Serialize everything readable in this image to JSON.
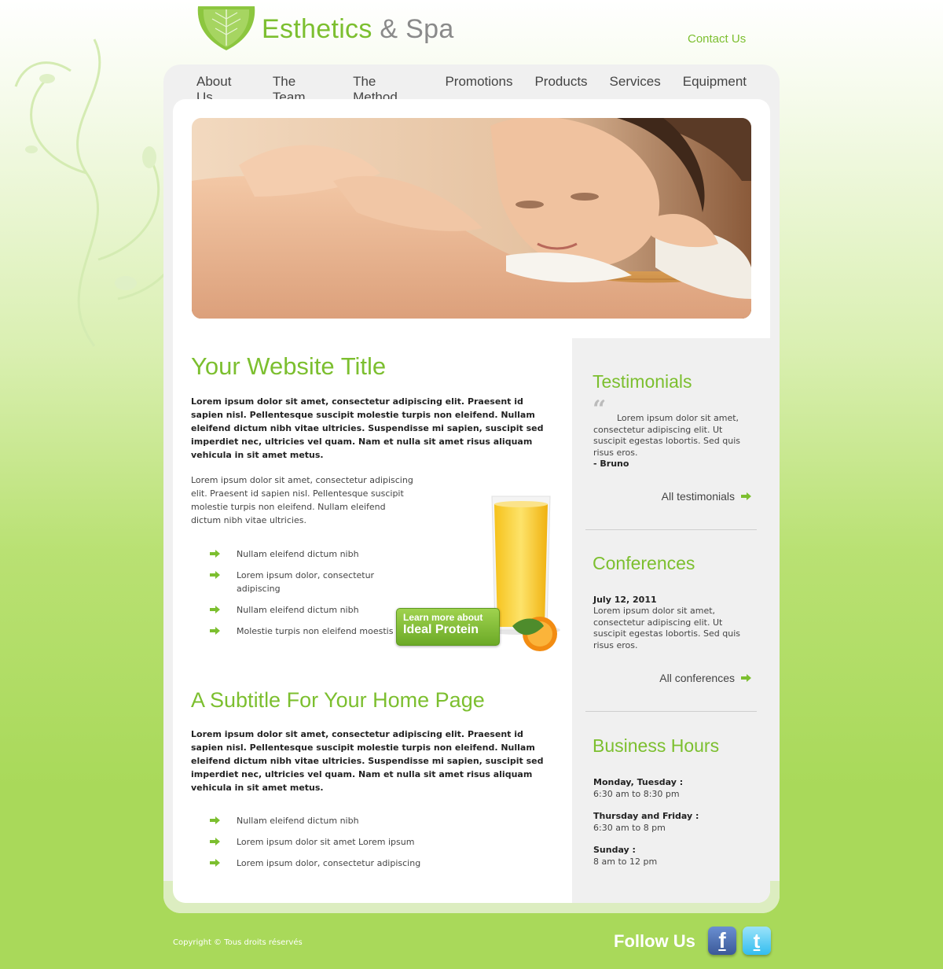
{
  "header": {
    "logo_part1": "Esthetics",
    "logo_amp": "&",
    "logo_part2": "Spa",
    "contact_label": "Contact Us"
  },
  "nav": {
    "items": [
      "About Us",
      "The Team",
      "The Method",
      "Promotions",
      "Products",
      "Services",
      "Equipment"
    ]
  },
  "main": {
    "title": "Your Website Title",
    "intro_bold": "Lorem ipsum dolor sit amet, consectetur adipiscing elit. Praesent id sapien nisl. Pellentesque suscipit molestie turpis non eleifend. Nullam eleifend dictum nibh vitae ultricies. Suspendisse mi sapien, suscipit sed imperdiet nec, ultricies vel quam. Nam et nulla sit amet risus aliquam vehicula in sit amet metus.",
    "intro_text": "Lorem ipsum dolor sit amet, consectetur adipiscing elit. Praesent id sapien nisl. Pellentesque suscipit molestie turpis non eleifend. Nullam eleifend dictum nibh vitae ultricies.",
    "list1": [
      "Nullam eleifend dictum nibh",
      "Lorem ipsum dolor, consectetur adipiscing",
      "Nullam eleifend dictum nibh",
      "Molestie turpis non eleifend moestis"
    ],
    "promo_line1": "Learn more about",
    "promo_line2": "Ideal Protein",
    "subtitle": "A Subtitle For Your Home Page",
    "sub_bold": "Lorem ipsum dolor sit amet, consectetur adipiscing elit. Praesent id sapien nisl. Pellentesque suscipit molestie turpis non eleifend. Nullam eleifend dictum nibh vitae ultricies. Suspendisse mi sapien, suscipit sed imperdiet nec, ultricies vel quam. Nam et nulla sit amet risus aliquam vehicula in sit amet metus.",
    "list2": [
      "Nullam eleifend dictum nibh",
      "Lorem ipsum dolor sit amet Lorem ipsum",
      "Lorem ipsum dolor, consectetur adipiscing"
    ]
  },
  "sidebar": {
    "testimonials_title": "Testimonials",
    "testimonial_text": "Lorem ipsum dolor sit amet, consectetur adipiscing elit. Ut suscipit egestas lobortis. Sed quis risus eros.",
    "testimonial_author": "- Bruno",
    "testimonials_link": "All testimonials",
    "conferences_title": "Conferences",
    "conference_date": "July 12, 2011",
    "conference_text": "Lorem ipsum dolor sit amet, consectetur adipiscing elit. Ut suscipit egestas lobortis. Sed quis risus eros.",
    "conferences_link": "All conferences",
    "hours_title": "Business Hours",
    "hours": [
      {
        "days": "Monday, Tuesday :",
        "time": "6:30 am to 8:30 pm"
      },
      {
        "days": "Thursday and Friday :",
        "time": "6:30 am to 8 pm"
      },
      {
        "days": "Sunday :",
        "time": "8 am to 12 pm"
      }
    ]
  },
  "footer": {
    "copyright": "Copyright © Tous droits réservés",
    "follow": "Follow Us",
    "facebook_icon": "facebook-icon",
    "twitter_icon": "twitter-icon"
  },
  "colors": {
    "accent": "#7cbf2f",
    "background_green": "#a9d95a",
    "sidebar_bg": "#f0f0f0"
  }
}
